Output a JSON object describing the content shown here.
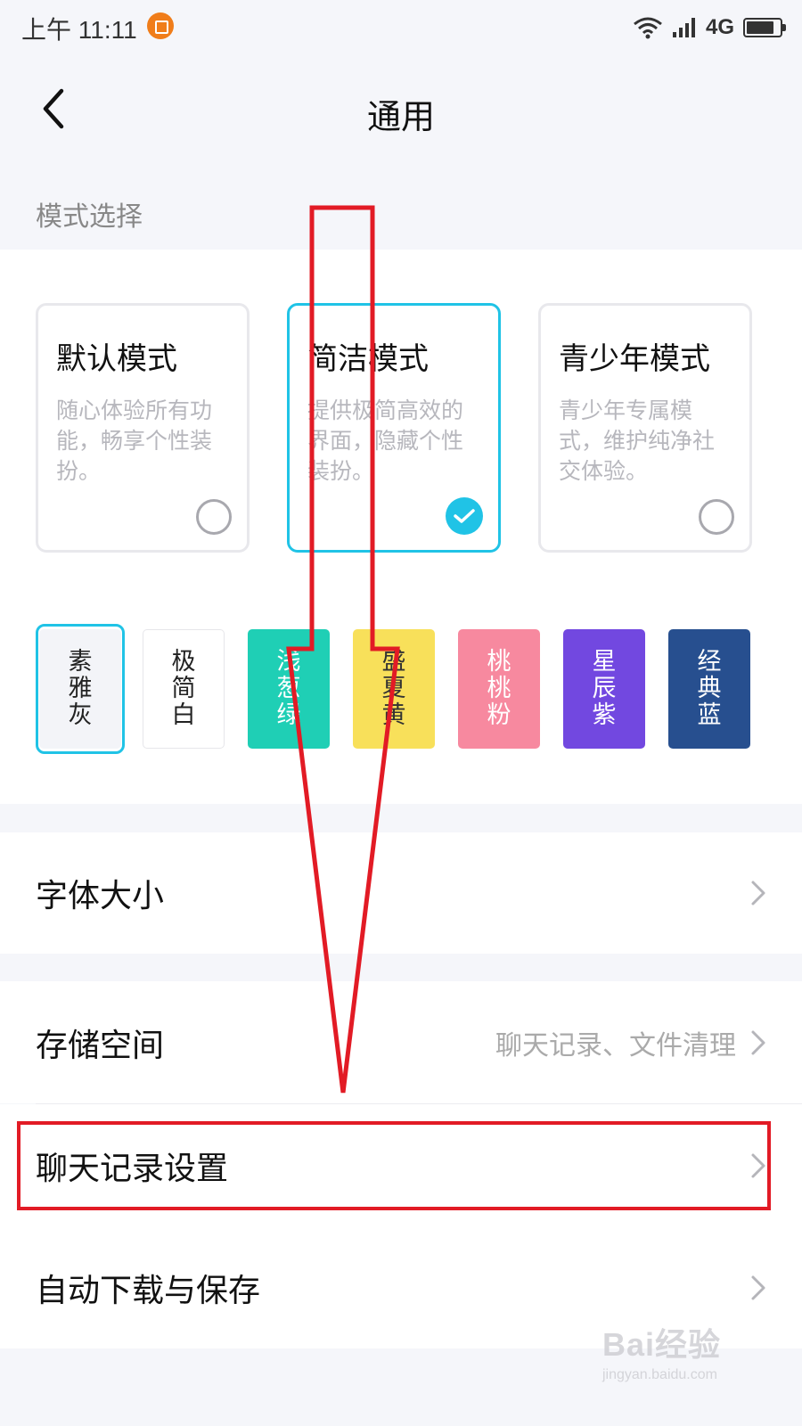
{
  "status_bar": {
    "time": "上午 11:11",
    "network": "4G"
  },
  "nav": {
    "title": "通用"
  },
  "mode_section": {
    "label": "模式选择",
    "modes": [
      {
        "name": "默认模式",
        "desc": "随心体验所有功能，畅享个性装扮。",
        "selected": false
      },
      {
        "name": "简洁模式",
        "desc": "提供极简高效的界面，隐藏个性装扮。",
        "selected": true
      },
      {
        "name": "青少年模式",
        "desc": "青少年专属模式，维护纯净社交体验。",
        "selected": false
      }
    ],
    "themes": [
      {
        "label": "素雅灰",
        "bg": "#f3f4f8",
        "fg": "#222222",
        "selected": true
      },
      {
        "label": "极简白",
        "bg": "#ffffff",
        "fg": "#222222",
        "selected": false
      },
      {
        "label": "浅葱绿",
        "bg": "#1fcfb5",
        "fg": "#ffffff",
        "selected": false
      },
      {
        "label": "盛夏黄",
        "bg": "#f8e05a",
        "fg": "#333333",
        "selected": false
      },
      {
        "label": "桃桃粉",
        "bg": "#f7899f",
        "fg": "#ffffff",
        "selected": false
      },
      {
        "label": "星辰紫",
        "bg": "#7248e0",
        "fg": "#ffffff",
        "selected": false
      },
      {
        "label": "经典蓝",
        "bg": "#274f8f",
        "fg": "#ffffff",
        "selected": false
      }
    ]
  },
  "menu": {
    "font_size": {
      "label": "字体大小"
    },
    "storage": {
      "label": "存储空间",
      "value": "聊天记录、文件清理"
    },
    "chat_history": {
      "label": "聊天记录设置"
    },
    "auto_download": {
      "label": "自动下载与保存"
    }
  },
  "watermark": {
    "logo": "Bai经验",
    "url": "jingyan.baidu.com"
  },
  "colors": {
    "accent": "#20c3e6",
    "annotation_red": "#e21b25",
    "page_bg": "#f5f6fa"
  }
}
